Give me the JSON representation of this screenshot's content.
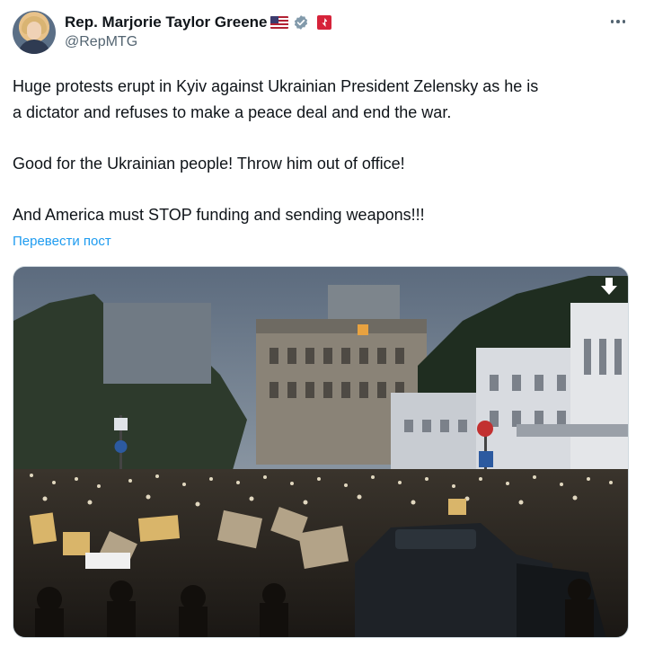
{
  "tweet": {
    "display_name": "Rep. Marjorie Taylor Greene",
    "handle": "@RepMTG",
    "text_lines": [
      "Huge protests erupt in Kyiv against Ukrainian President Zelensky as he is",
      "a dictator and refuses to make a peace deal and end the war.",
      "Good for the Ukrainian people! Throw him out of office!",
      "And America must STOP funding and sending weapons!!!"
    ],
    "translate_label": "Перевести пост"
  },
  "icons": {
    "flag": "us-flag-icon",
    "verified": "verified-badge-icon",
    "label": "government-label-icon",
    "more": "more-icon",
    "download": "download-arrow-icon"
  },
  "colors": {
    "text": "#0f1419",
    "secondary": "#536471",
    "link": "#1d9bf0",
    "border": "#cfd9de"
  }
}
